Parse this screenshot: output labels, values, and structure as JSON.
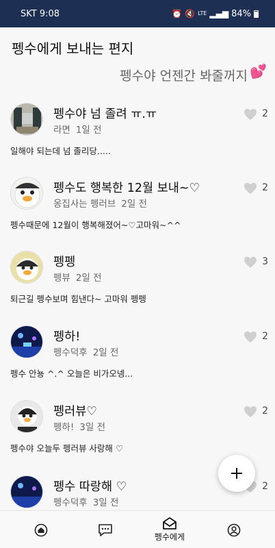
{
  "status": {
    "carrier": "SKT 9:08",
    "network": "LTE",
    "battery": "84%"
  },
  "app": {
    "title": "펭수에게 보내는 편지",
    "subtitle": "펭수야 언젠간 봐줄꺼지"
  },
  "posts": [
    {
      "title": "펭수야 넘 졸려 ㅠ.ㅠ",
      "author": "라면",
      "time": "1일 전",
      "likes": "2",
      "body": "일해야 되는데 넘 졸리당....."
    },
    {
      "title": "펭수도 행복한 12월 보내~♡",
      "author": "옹집사는 펭러브",
      "time": "2일 전",
      "likes": "2",
      "body": "펭수때문에 12월이 행복해졌어~♡고마워~^^"
    },
    {
      "title": "펭펭",
      "author": "펭뷰",
      "time": "2일 전",
      "likes": "3",
      "body": "퇴근길 펭수보며 힘낸다~ 고마워 펭펭"
    },
    {
      "title": "펭하!",
      "author": "펭수덕후",
      "time": "2일 전",
      "likes": "2",
      "body": "펭수 안뇽 ^.^ 오늘은 비가오넹..."
    },
    {
      "title": "펭러뷰♡",
      "author": "펭하!",
      "time": "3일 전",
      "likes": "2",
      "body": "펭수야 오늘두 펭러뷰 사랑해 ♡"
    },
    {
      "title": "펭수 따랑해 ♡",
      "author": "펭수덕후",
      "time": "3일 전",
      "likes": "2",
      "body": ""
    }
  ],
  "nav": {
    "letters_label": "펭수에게"
  },
  "colors": {
    "statusbar": "#1d2f52",
    "accent_heart": "#ff5aa8",
    "heart_gray": "#cfcfcf"
  }
}
